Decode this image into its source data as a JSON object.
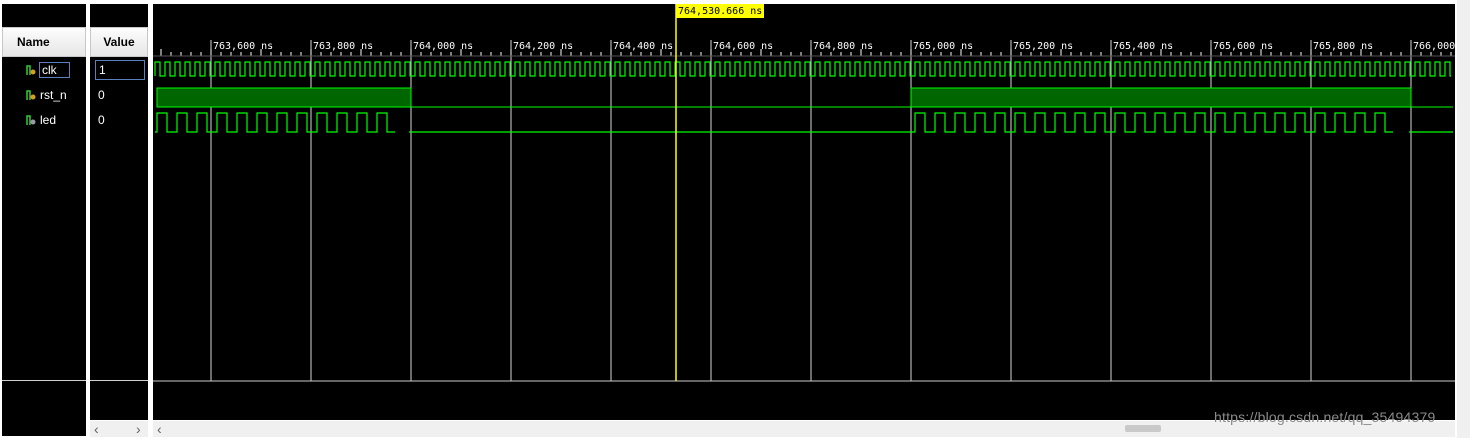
{
  "columns": {
    "name": "Name",
    "value": "Value"
  },
  "signals": [
    {
      "name": "clk",
      "value": "1",
      "icon": "bit-signal-icon"
    },
    {
      "name": "rst_n",
      "value": "0",
      "icon": "bit-signal-icon"
    },
    {
      "name": "led",
      "value": "0",
      "icon": "bit-signal-icon"
    }
  ],
  "cursor": {
    "label": "764,530.666 ns"
  },
  "time_axis": {
    "ticks": [
      "763,600 ns",
      "763,800 ns",
      "764,000 ns",
      "764,200 ns",
      "764,400 ns",
      "764,600 ns",
      "764,800 ns",
      "765,000 ns",
      "765,200 ns",
      "765,400 ns",
      "765,600 ns",
      "765,800 ns",
      "766,000"
    ]
  },
  "colors": {
    "wave": "#00ff00",
    "bus_fill": "#006600",
    "cursor": "#ffff00",
    "background": "#000000",
    "grid": "#ffffff"
  },
  "watermark": "https://blog.csdn.net/qq_35494379",
  "icons": {
    "scroll_left": "chevron-left-icon",
    "scroll_right": "chevron-right-icon",
    "scroll_left_wave": "chevron-left-icon"
  }
}
